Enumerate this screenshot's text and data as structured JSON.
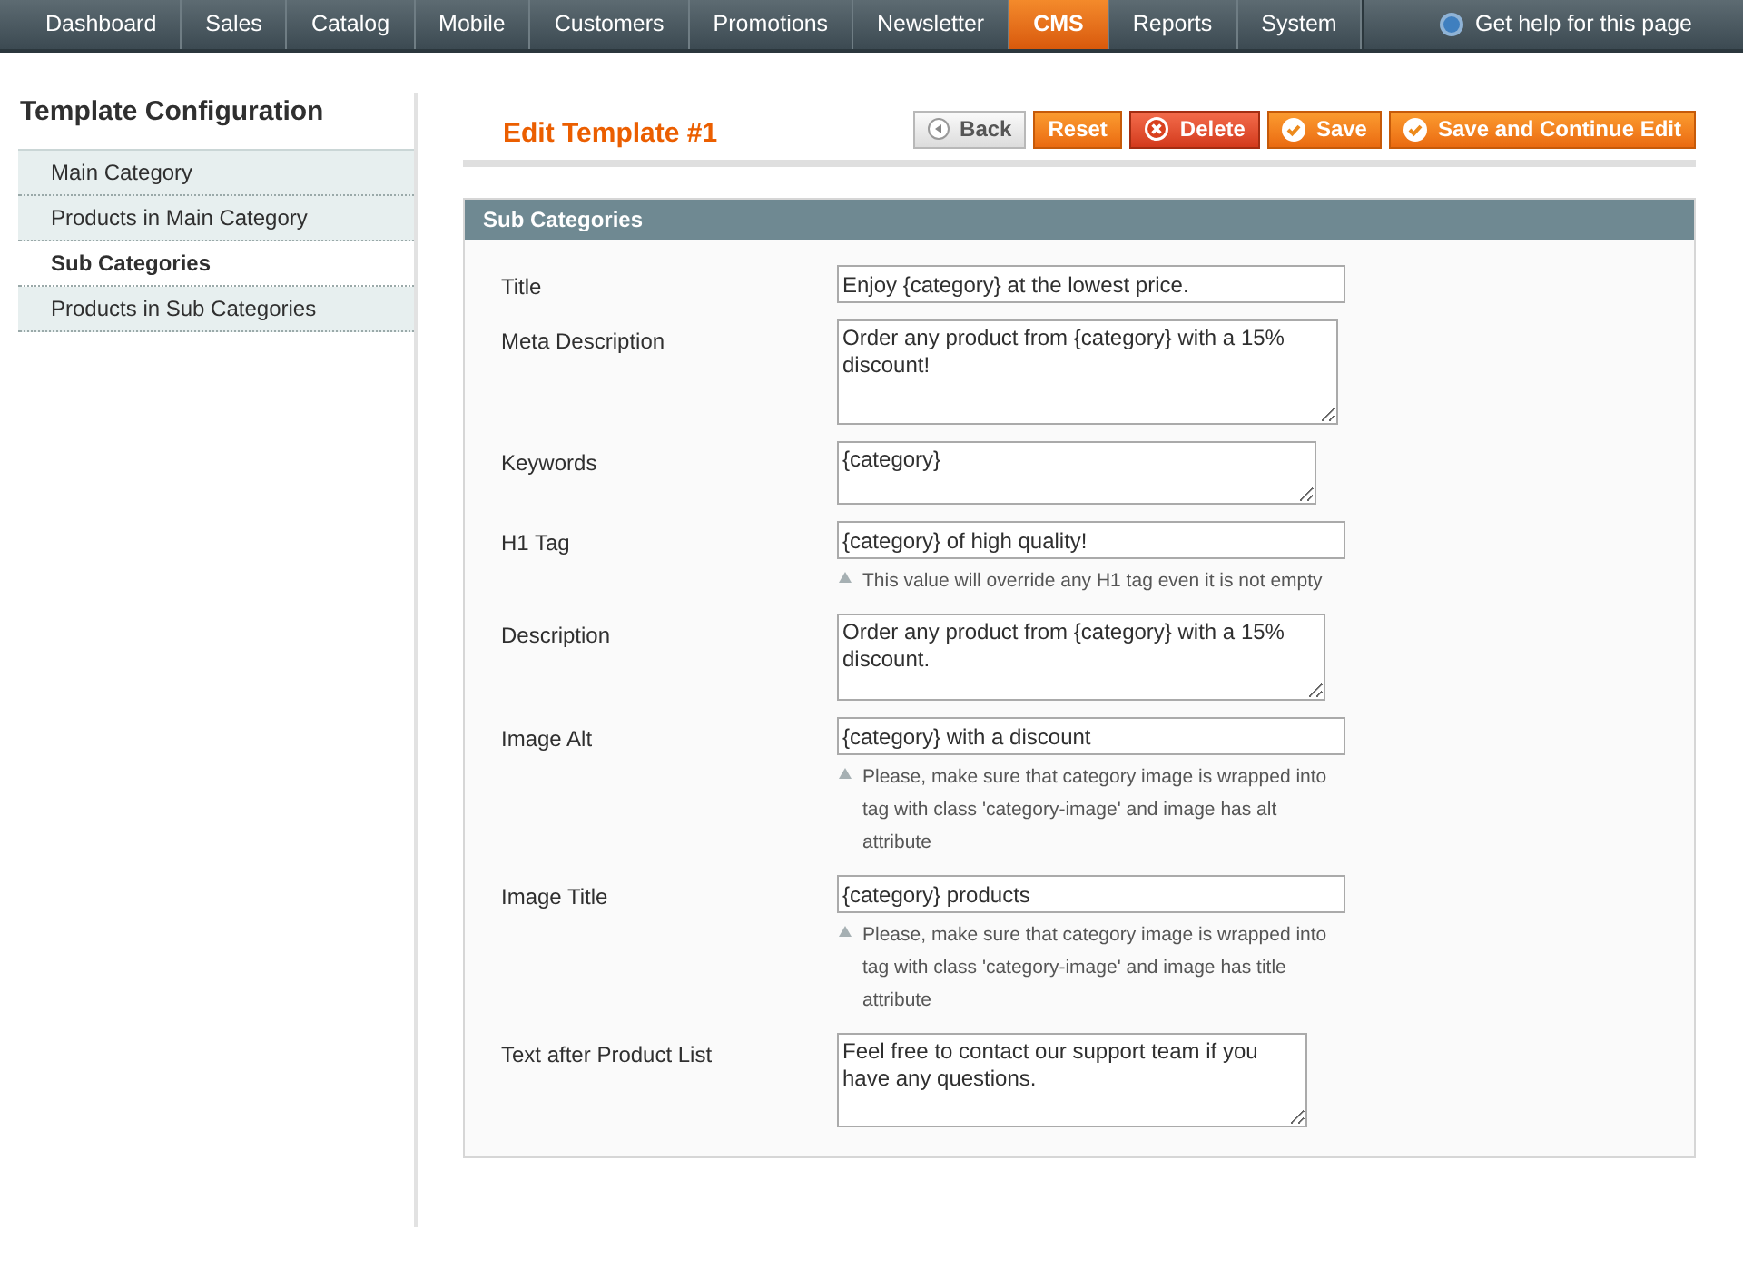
{
  "nav": {
    "items": [
      {
        "label": "Dashboard",
        "selected": false
      },
      {
        "label": "Sales",
        "selected": false
      },
      {
        "label": "Catalog",
        "selected": false
      },
      {
        "label": "Mobile",
        "selected": false
      },
      {
        "label": "Customers",
        "selected": false
      },
      {
        "label": "Promotions",
        "selected": false
      },
      {
        "label": "Newsletter",
        "selected": false
      },
      {
        "label": "CMS",
        "selected": true
      },
      {
        "label": "Reports",
        "selected": false
      },
      {
        "label": "System",
        "selected": false
      }
    ],
    "help": "Get help for this page"
  },
  "sidebar": {
    "title": "Template Configuration",
    "items": [
      {
        "label": "Main Category",
        "selected": false
      },
      {
        "label": "Products in Main Category",
        "selected": false
      },
      {
        "label": "Sub Categories",
        "selected": true
      },
      {
        "label": "Products in Sub Categories",
        "selected": false
      }
    ]
  },
  "page_title": "Edit Template #1",
  "buttons": [
    {
      "kind": "back",
      "label": "Back"
    },
    {
      "kind": "reset",
      "label": "Reset"
    },
    {
      "kind": "delete",
      "label": "Delete"
    },
    {
      "kind": "save",
      "label": "Save"
    },
    {
      "kind": "save",
      "label": "Save and Continue Edit"
    }
  ],
  "section": {
    "title": "Sub Categories",
    "fields": [
      {
        "label": "Title",
        "kind": "input",
        "value": "Enjoy {category} at the lowest price."
      },
      {
        "label": "Meta Description",
        "kind": "textarea",
        "value": "Order any product from {category} with a 15% discount!"
      },
      {
        "label": "Keywords",
        "kind": "textarea",
        "value": "{category}"
      },
      {
        "label": "H1 Tag",
        "kind": "input",
        "value": "{category} of high quality!",
        "hint": "This value will override any H1 tag even it is not empty"
      },
      {
        "label": "Description",
        "kind": "textarea",
        "value": "Order any product from {category} with a 15% discount."
      },
      {
        "label": "Image Alt",
        "kind": "input",
        "value": "{category} with a discount",
        "hint": "Please, make sure that category image is wrapped into tag with class 'category-image' and image has alt attribute"
      },
      {
        "label": "Image Title",
        "kind": "input",
        "value": "{category} products",
        "hint": "Please, make sure that category image is wrapped into tag with class 'category-image' and image has title attribute"
      },
      {
        "label": "Text after Product List",
        "kind": "textarea",
        "value": "Feel free to contact our support team if you have any questions."
      }
    ]
  }
}
